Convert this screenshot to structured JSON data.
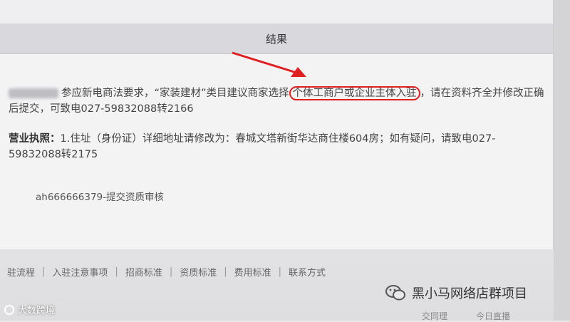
{
  "header": {
    "title": "结果"
  },
  "message": {
    "line1_prefix": "参应新电商法要求，“家装建材”类目建议商家选择",
    "highlight": "个体工商户或企业主体入驻",
    "line1_suffix": "，请在资料齐全并修改正确后提交，可致电027-59832088转2166"
  },
  "license": {
    "label": "营业执照：",
    "text": "1.住址（身份证）详细地址请修改为：春城文塔新街华达商住楼604房；如有疑问，请致电027-59832088转2175"
  },
  "submit_log": "ah666666379-提交资质审核",
  "footer": {
    "links": [
      "驻流程",
      "入驻注意事项",
      "招商标准",
      "资质标准",
      "费用标准",
      "联系方式"
    ]
  },
  "watermarks": {
    "left": "大数跨境",
    "right": "黑小马网络店群项目",
    "bottom_left": "交同理",
    "bottom_right": "今日直播"
  },
  "colors": {
    "highlight": "#e02020",
    "arrow": "#e02020"
  }
}
